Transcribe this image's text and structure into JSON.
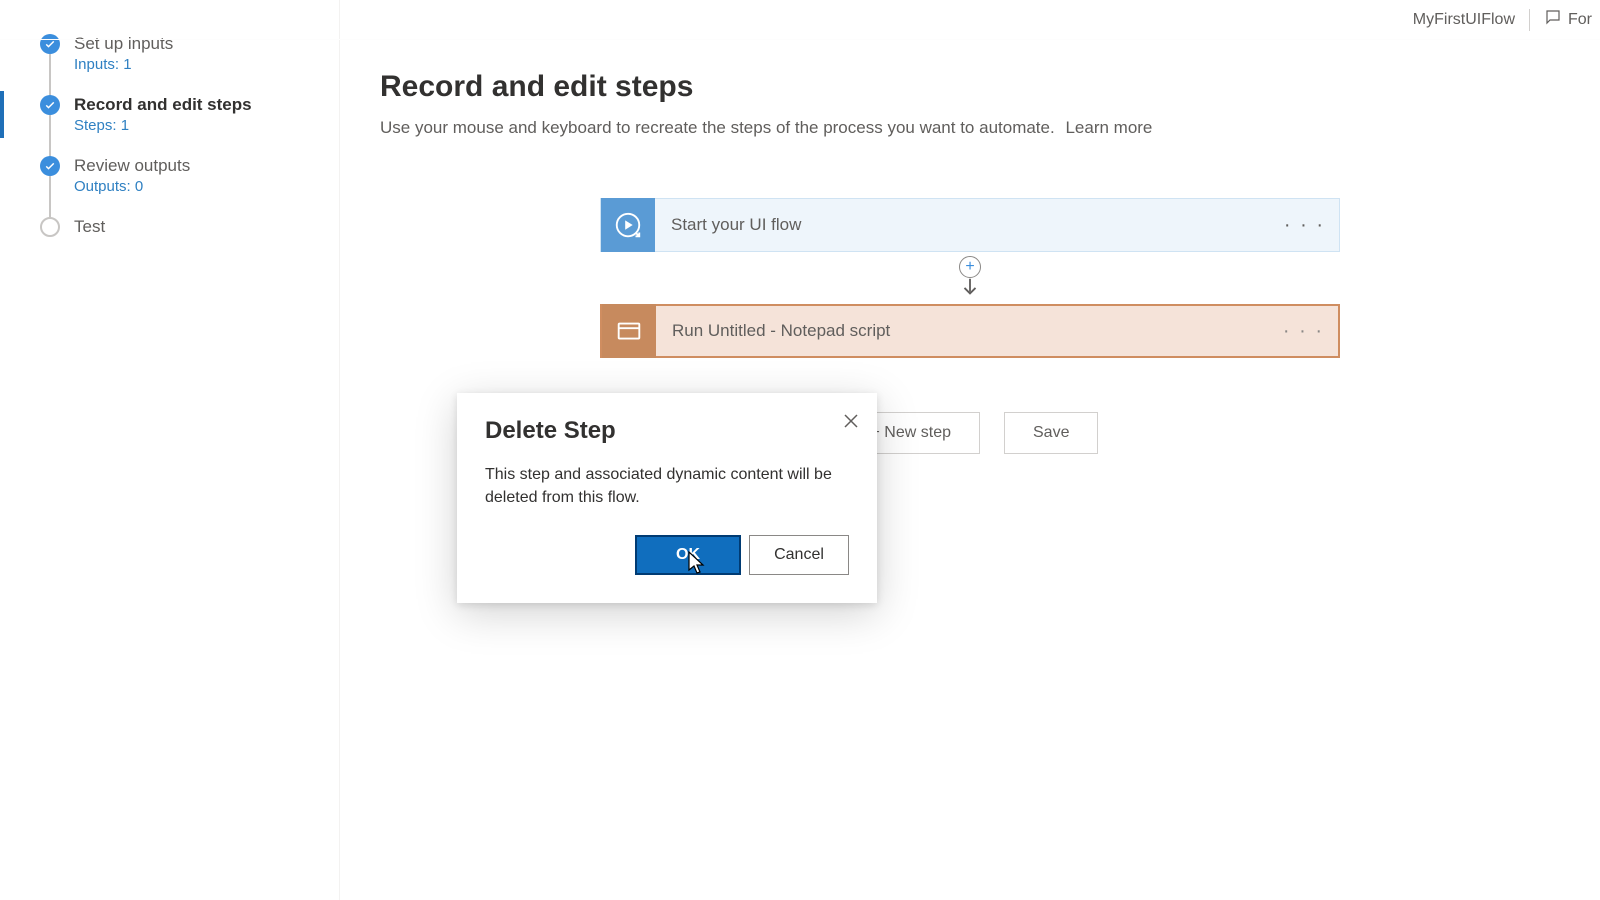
{
  "header": {
    "flow_name": "MyFirstUIFlow",
    "feedback_label": "For"
  },
  "sidebar": {
    "items": [
      {
        "title": "Set up inputs",
        "meta": "Inputs: 1",
        "done": true,
        "current": false
      },
      {
        "title": "Record and edit steps",
        "meta": "Steps: 1",
        "done": true,
        "current": true
      },
      {
        "title": "Review outputs",
        "meta": "Outputs: 0",
        "done": true,
        "current": false
      },
      {
        "title": "Test",
        "meta": "",
        "done": false,
        "current": false
      }
    ]
  },
  "main": {
    "heading": "Record and edit steps",
    "subtext": "Use your mouse and keyboard to recreate the steps of the process you want to automate.",
    "learn_more": "Learn more"
  },
  "flow": {
    "start_label": "Start your UI flow",
    "step1_label": "Run Untitled - Notepad script"
  },
  "actions": {
    "new_step": "+ New step",
    "save": "Save"
  },
  "modal": {
    "title": "Delete Step",
    "body": "This step and associated dynamic content will be deleted from this flow.",
    "ok": "OK",
    "cancel": "Cancel"
  }
}
